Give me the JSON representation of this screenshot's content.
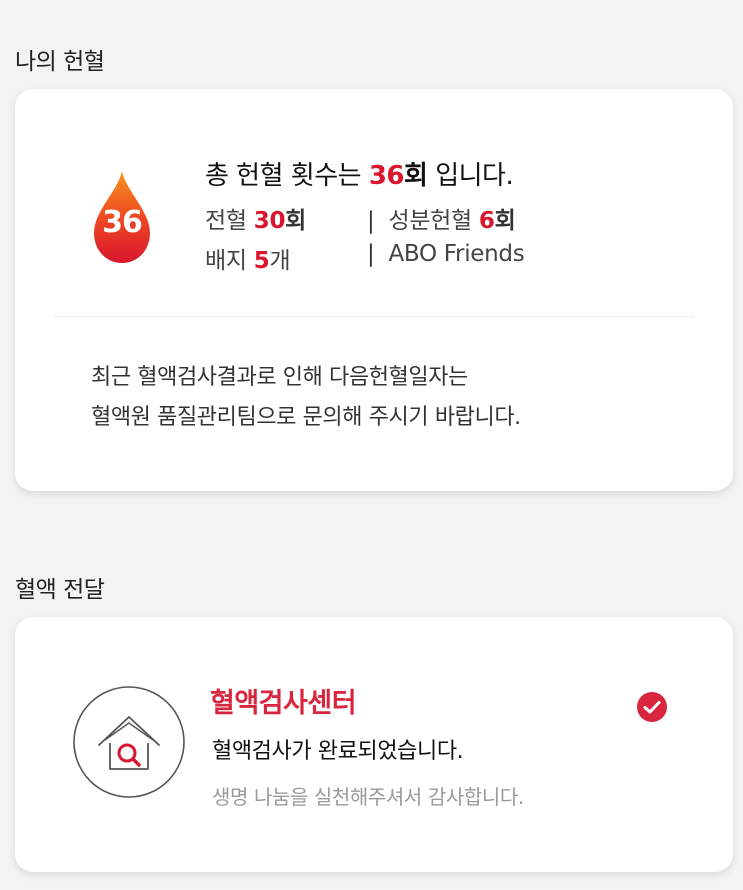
{
  "my_donation": {
    "section_title": "나의 헌혈",
    "badge_number": "36",
    "headline": {
      "prefix": "총 헌혈 횟수는 ",
      "count": "36",
      "unit": "회",
      "suffix": " 입니다."
    },
    "whole_blood": {
      "label": "전혈 ",
      "count": "30",
      "unit": "회"
    },
    "component": {
      "label": "성분헌혈 ",
      "count": "6",
      "unit": "회"
    },
    "badges": {
      "label": "배지 ",
      "count": "5",
      "unit": "개"
    },
    "membership": "ABO Friends",
    "separator": "|",
    "notice_line1": "최근 혈액검사결과로 인해 다음헌혈일자는",
    "notice_line2": "혈액원 품질관리팀으로 문의해 주시기 바랍니다."
  },
  "blood_delivery": {
    "section_title": "혈액 전달",
    "icon": "house-search-icon",
    "center_name": "혈액검사센터",
    "status": "혈액검사가 완료되었습니다.",
    "thanks": "생명 나눔을 실천해주셔서 감사합니다.",
    "status_icon": "check-circle-icon"
  },
  "colors": {
    "accent_red": "#d9162e",
    "background": "#f3f3f3",
    "card": "#ffffff",
    "muted_text": "#9a9a9a"
  }
}
